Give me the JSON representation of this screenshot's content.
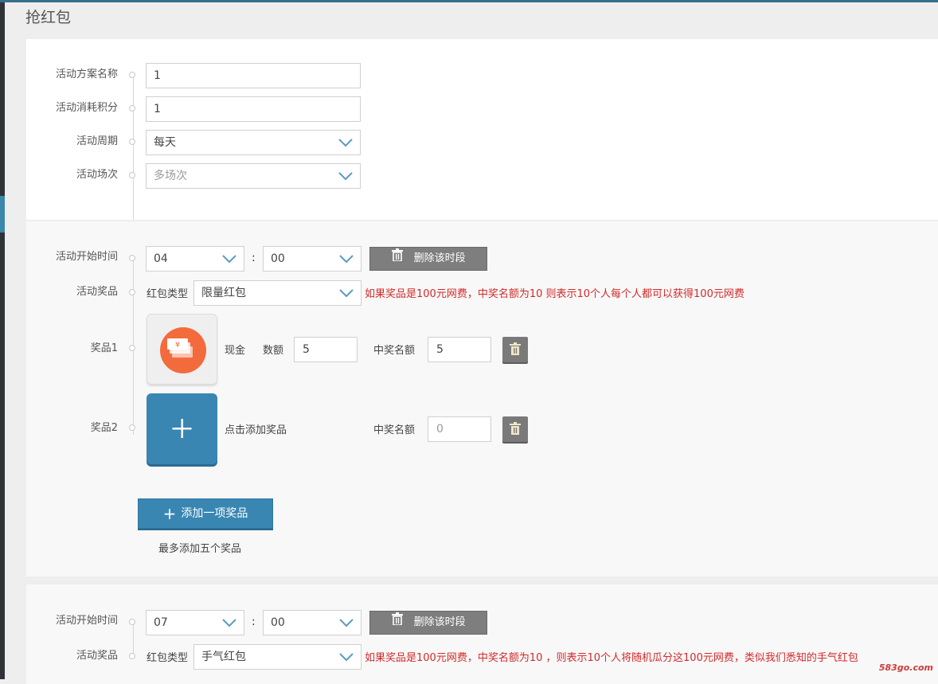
{
  "page_title": "抢红包",
  "basic": {
    "name_label": "活动方案名称",
    "name_value": "1",
    "cost_label": "活动消耗积分",
    "cost_value": "1",
    "period_label": "活动周期",
    "period_value": "每天",
    "session_label": "活动场次",
    "session_placeholder": "多场次"
  },
  "slots": [
    {
      "start_label": "活动开始时间",
      "hour": "04",
      "colon": ":",
      "minute": "00",
      "delete_label": "删除该时段",
      "prize_label": "活动奖品",
      "type_label": "红包类型",
      "type_value": "限量红包",
      "hint": "如果奖品是100元网费，中奖名额为10 则表示10个人每个人都可以获得100元网费",
      "prizes": [
        {
          "label": "奖品1",
          "name": "现金",
          "qty_label": "数额",
          "qty": "5",
          "winners_label": "中奖名额",
          "winners": "5"
        },
        {
          "label": "奖品2",
          "name": "点击添加奖品",
          "winners_label": "中奖名额",
          "winners_placeholder": "0"
        }
      ],
      "add_button": "添加一项奖品",
      "add_note": "最多添加五个奖品"
    },
    {
      "start_label": "活动开始时间",
      "hour": "07",
      "colon": ":",
      "minute": "00",
      "delete_label": "删除该时段",
      "prize_label": "活动奖品",
      "type_label": "红包类型",
      "type_value": "手气红包",
      "hint": "如果奖品是100元网费，中奖名额为10 ，则表示10个人将随机瓜分这100元网费，类似我们悉知的手气红包"
    }
  ],
  "watermark": "583go.com",
  "icons": {
    "chevron": "chevron-down-icon",
    "trash": "trash-icon",
    "plus": "plus-icon",
    "cash": "cash-icon"
  },
  "colors": {
    "accent": "#3a86b2",
    "hint_red": "#d32a2a",
    "cash_orange": "#f36b3c",
    "delete_gray": "#7e7e7e"
  }
}
